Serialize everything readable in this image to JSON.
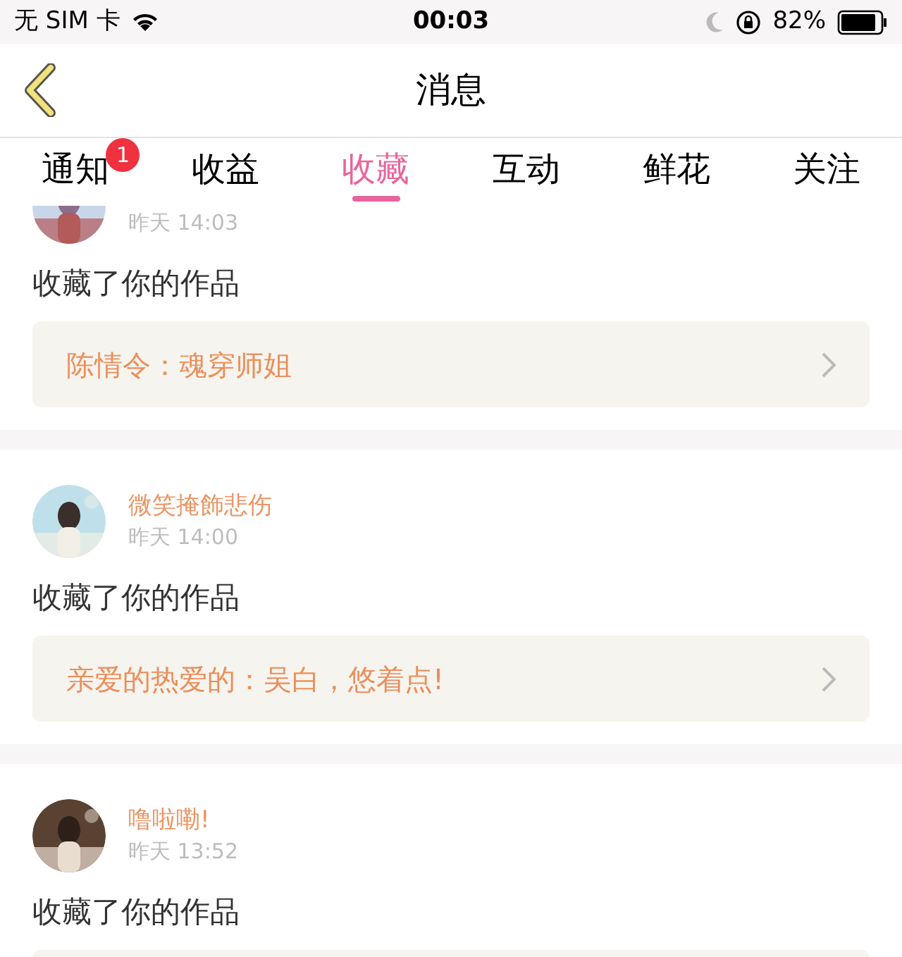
{
  "status_bar": {
    "carrier": "无 SIM 卡",
    "time": "00:03",
    "battery": "82%"
  },
  "nav": {
    "title": "消息"
  },
  "tabs": [
    {
      "label": "通知",
      "selected": false,
      "badge": "1"
    },
    {
      "label": "收益",
      "selected": false
    },
    {
      "label": "收藏",
      "selected": true
    },
    {
      "label": "互动",
      "selected": false
    },
    {
      "label": "鲜花",
      "selected": false
    },
    {
      "label": "关注",
      "selected": false
    }
  ],
  "items": [
    {
      "time": "昨天 14:03",
      "action": "收藏了你的作品",
      "work": "陈情令：魂穿师姐"
    },
    {
      "name": "微笑掩飾悲伤",
      "time": "昨天 14:00",
      "action": "收藏了你的作品",
      "work": "亲爱的热爱的：吴白，悠着点!"
    },
    {
      "name": "噜啦嘞!",
      "time": "昨天 13:52",
      "action": "收藏了你的作品"
    }
  ]
}
